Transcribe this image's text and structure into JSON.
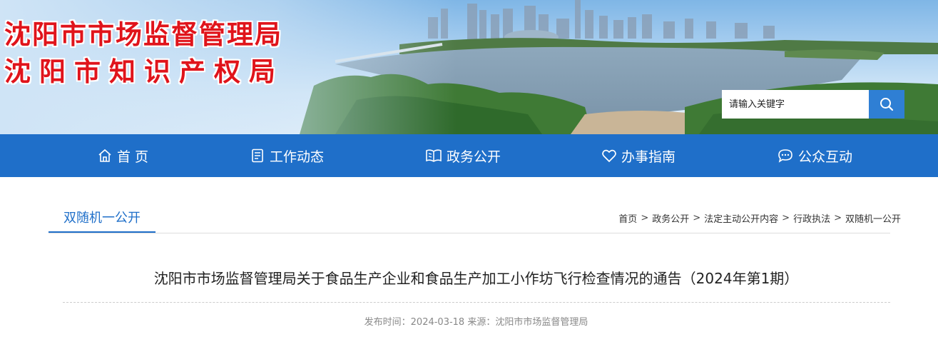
{
  "header": {
    "title_line1": "沈阳市市场监督管理局",
    "title_line2": "沈阳市知识产权局",
    "search": {
      "placeholder": "请输入关键字"
    }
  },
  "nav": {
    "items": [
      {
        "label": "首 页",
        "icon": "home-icon"
      },
      {
        "label": "工作动态",
        "icon": "document-icon"
      },
      {
        "label": "政务公开",
        "icon": "book-icon"
      },
      {
        "label": "办事指南",
        "icon": "heart-icon"
      },
      {
        "label": "公众互动",
        "icon": "chat-icon"
      }
    ]
  },
  "section": {
    "tab_label": "双随机一公开",
    "breadcrumb": [
      "首页",
      "政务公开",
      "法定主动公开内容",
      "行政执法",
      "双随机一公开"
    ],
    "separator": ">"
  },
  "article": {
    "title": "沈阳市市场监督管理局关于食品生产企业和食品生产加工小作坊飞行检查情况的通告（2024年第1期）",
    "meta": "发布时间：2024-03-18 来源：沈阳市市场监督管理局"
  },
  "colors": {
    "brand_blue": "#1f6fc9",
    "title_red": "#e0141b",
    "search_button": "#2f7fd4"
  }
}
